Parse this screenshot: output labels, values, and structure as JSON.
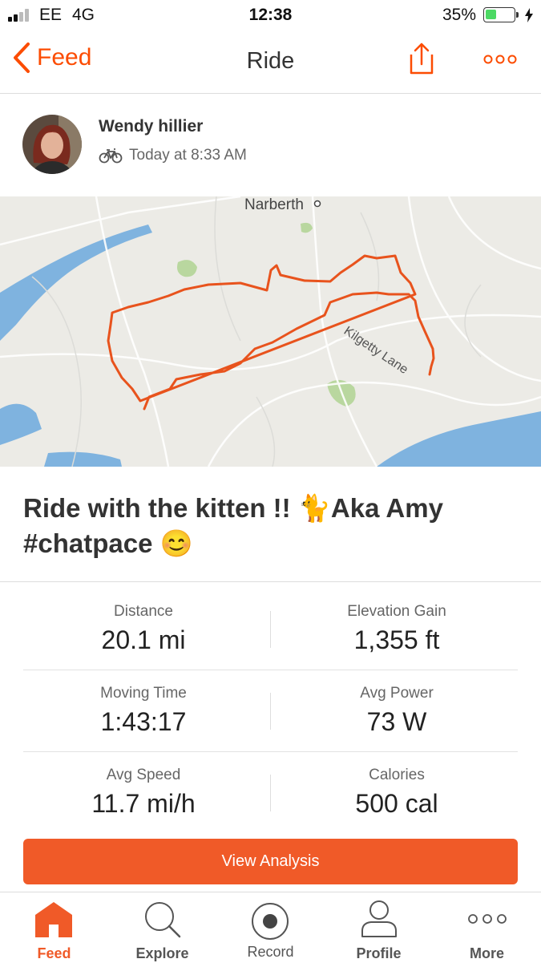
{
  "status": {
    "carrier": "EE",
    "network": "4G",
    "time": "12:38",
    "battery": "35%"
  },
  "nav": {
    "back_label": "Feed",
    "title": "Ride",
    "share_icon": "share-icon",
    "more_icon": "more-icon"
  },
  "activity": {
    "athlete": "Wendy hillier",
    "time": "Today at 8:33 AM",
    "sport_icon": "bike-icon",
    "title": "Ride with the kitten !! 🐈Aka Amy #chatpace 😊"
  },
  "map": {
    "place_label": "Narberth",
    "road_label": "Kilgetty Lane",
    "route_color": "#e8531d"
  },
  "stats": [
    {
      "label": "Distance",
      "value": "20.1 mi"
    },
    {
      "label": "Elevation Gain",
      "value": "1,355 ft"
    },
    {
      "label": "Moving Time",
      "value": "1:43:17"
    },
    {
      "label": "Avg Power",
      "value": "73 W"
    },
    {
      "label": "Avg Speed",
      "value": "11.7 mi/h"
    },
    {
      "label": "Calories",
      "value": "500 cal"
    }
  ],
  "analysis_button": "View Analysis",
  "tabs": [
    {
      "label": "Feed",
      "icon": "home-icon",
      "active": true
    },
    {
      "label": "Explore",
      "icon": "search-icon",
      "active": false
    },
    {
      "label": "Record",
      "icon": "record-icon",
      "active": false
    },
    {
      "label": "Profile",
      "icon": "profile-icon",
      "active": false
    },
    {
      "label": "More",
      "icon": "more-icon",
      "active": false
    }
  ],
  "colors": {
    "accent": "#fc4c02",
    "button": "#f05a28",
    "battery": "#4cd964"
  }
}
